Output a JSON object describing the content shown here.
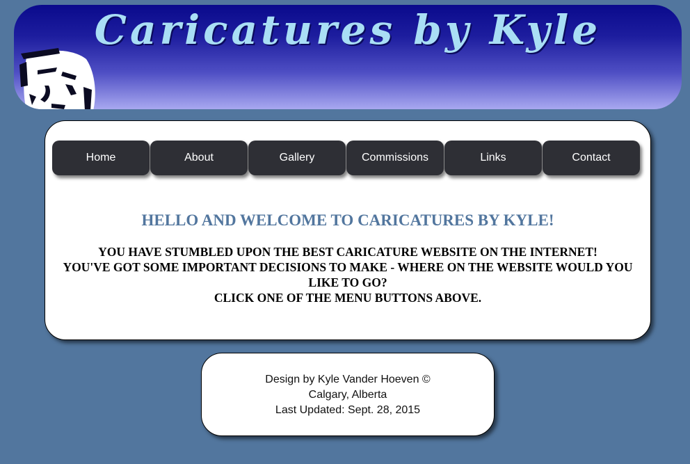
{
  "banner": {
    "title": "Caricatures by Kyle"
  },
  "nav": {
    "items": [
      {
        "label": "Home"
      },
      {
        "label": "About"
      },
      {
        "label": "Gallery"
      },
      {
        "label": "Commissions"
      },
      {
        "label": "Links"
      },
      {
        "label": "Contact"
      }
    ]
  },
  "main": {
    "heading": "HELLO AND WELCOME TO CARICATURES BY KYLE!",
    "lines": [
      "YOU HAVE STUMBLED UPON THE BEST CARICATURE WEBSITE ON THE INTERNET!",
      "YOU'VE GOT SOME IMPORTANT DECISIONS TO MAKE - WHERE ON THE WEBSITE WOULD YOU LIKE TO GO?",
      "CLICK ONE OF THE MENU BUTTONS ABOVE."
    ]
  },
  "footer": {
    "design": "Design by Kyle Vander Hoeven ©",
    "location": "Calgary, Alberta",
    "updated": "Last Updated: Sept. 28, 2015"
  },
  "colors": {
    "page_background": "#52769e",
    "banner_top": "#0a0a8c",
    "banner_bottom": "#a8a8f0",
    "banner_title": "#a9def5",
    "nav_button": "#2e2f35",
    "heading": "#52769e"
  }
}
